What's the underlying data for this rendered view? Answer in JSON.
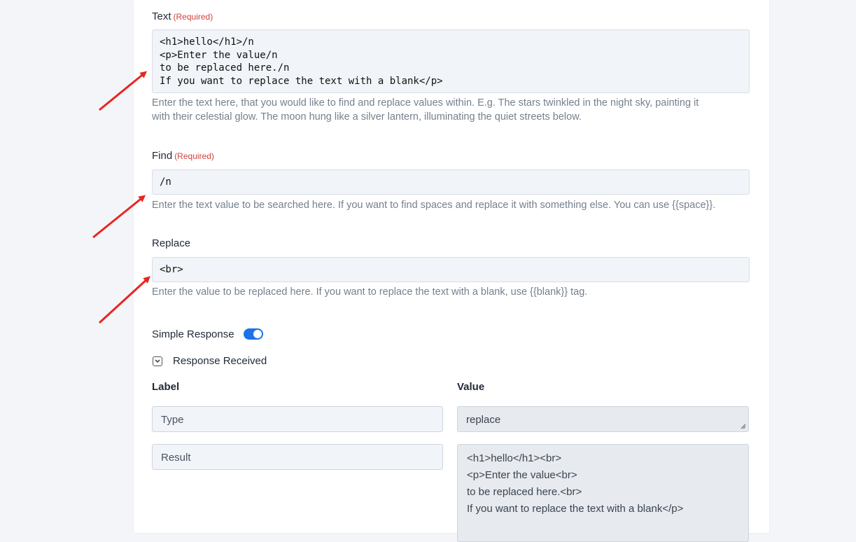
{
  "text_field": {
    "label": "Text",
    "required": "(Required)",
    "value": "<h1>hello</h1>/n\n<p>Enter the value/n\nto be replaced here./n\nIf you want to replace the text with a blank</p>",
    "help": "Enter the text here, that you would like to find and replace values within. E.g. The stars twinkled in the night sky, painting it\nwith their celestial glow. The moon hung like a silver lantern, illuminating the quiet streets below."
  },
  "find_field": {
    "label": "Find",
    "required": "(Required)",
    "value": "/n",
    "help": "Enter the text value to be searched here. If you want to find spaces and replace it with something else. You can use {{space}}."
  },
  "replace_field": {
    "label": "Replace",
    "value": "<br>",
    "help": "Enter the value to be replaced here. If you want to replace the text with a blank, use {{blank}} tag."
  },
  "simple_response": {
    "label": "Simple Response",
    "enabled": true
  },
  "response_received": {
    "label": "Response Received"
  },
  "table": {
    "col_label": "Label",
    "col_value": "Value",
    "rows": [
      {
        "label": "Type",
        "value": "replace"
      },
      {
        "label": "Result",
        "value": "<h1>hello</h1><br>\n<p>Enter the value<br>\nto be replaced here.<br>\nIf you want to replace the text with a blank</p>"
      }
    ]
  },
  "colors": {
    "accent": "#1a73e8",
    "required": "#d0423b",
    "arrow": "#e8251f"
  }
}
